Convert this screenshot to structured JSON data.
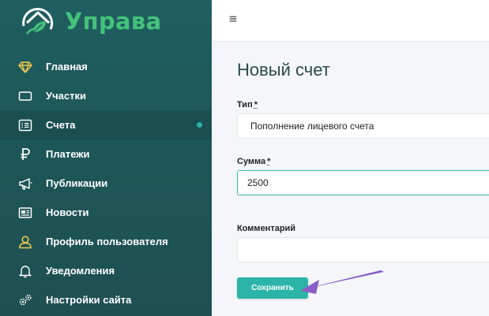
{
  "brand": {
    "name": "Управа",
    "color": "#43c27a"
  },
  "sidebar": {
    "items": [
      {
        "label": "Главная",
        "icon": "diamond-icon"
      },
      {
        "label": "Участки",
        "icon": "rectangle-icon"
      },
      {
        "label": "Счета",
        "icon": "list-box-icon",
        "active": true
      },
      {
        "label": "Платежи",
        "icon": "ruble-icon"
      },
      {
        "label": "Публикации",
        "icon": "megaphone-icon"
      },
      {
        "label": "Новости",
        "icon": "newspaper-icon"
      },
      {
        "label": "Профиль пользователя",
        "icon": "user-icon"
      },
      {
        "label": "Уведомления",
        "icon": "bell-icon"
      },
      {
        "label": "Настройки сайта",
        "icon": "gears-icon"
      }
    ]
  },
  "topbar": {
    "menu_icon": "hamburger-icon"
  },
  "form": {
    "title": "Новый счет",
    "type": {
      "label": "Тип",
      "required_mark": "*",
      "value": "Пополнение лицевого счета"
    },
    "amount": {
      "label": "Сумма",
      "required_mark": "*",
      "value": "2500"
    },
    "comment": {
      "label": "Комментарий",
      "value": ""
    },
    "save_label": "Сохранить"
  },
  "colors": {
    "accent": "#2ab5a8",
    "sidebar": "#1f5e60",
    "arrow": "#8a5ec6"
  }
}
